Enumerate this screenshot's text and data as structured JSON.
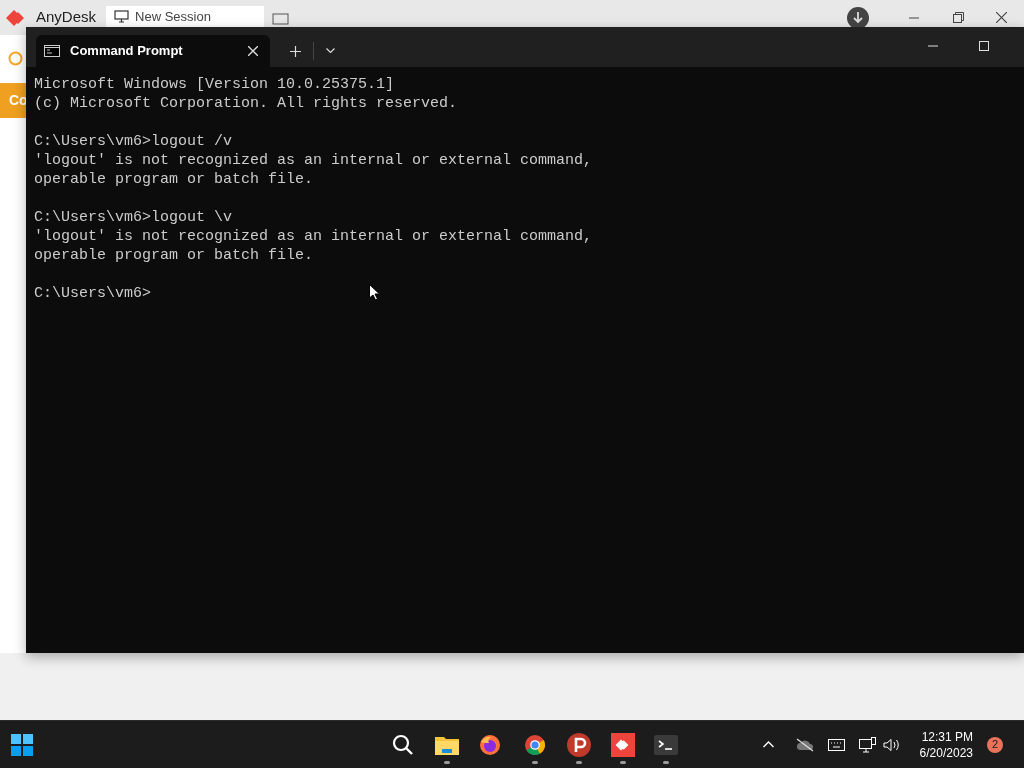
{
  "anydesk": {
    "app_name": "AnyDesk",
    "tab_title": "New Session"
  },
  "remote_background": {
    "partial_text": "Co"
  },
  "terminal": {
    "tab_title": "Command Prompt",
    "blocks": [
      [
        "Microsoft Windows [Version 10.0.25375.1]",
        "(c) Microsoft Corporation. All rights reserved."
      ],
      [
        "C:\\Users\\vm6>logout /v",
        "'logout' is not recognized as an internal or external command,",
        "operable program or batch file."
      ],
      [
        "C:\\Users\\vm6>logout \\v",
        "'logout' is not recognized as an internal or external command,",
        "operable program or batch file."
      ],
      [
        "C:\\Users\\vm6>"
      ]
    ]
  },
  "taskbar": {
    "apps": [
      {
        "kind": "start",
        "running": false
      },
      {
        "kind": "search",
        "running": false
      },
      {
        "kind": "explorer",
        "running": true
      },
      {
        "kind": "firefox",
        "running": false
      },
      {
        "kind": "chrome",
        "running": true
      },
      {
        "kind": "psiphon",
        "running": true
      },
      {
        "kind": "anydesk",
        "running": true
      },
      {
        "kind": "terminal",
        "running": true
      }
    ],
    "time": "12:31 PM",
    "date": "6/20/2023",
    "notification_count": "2"
  }
}
